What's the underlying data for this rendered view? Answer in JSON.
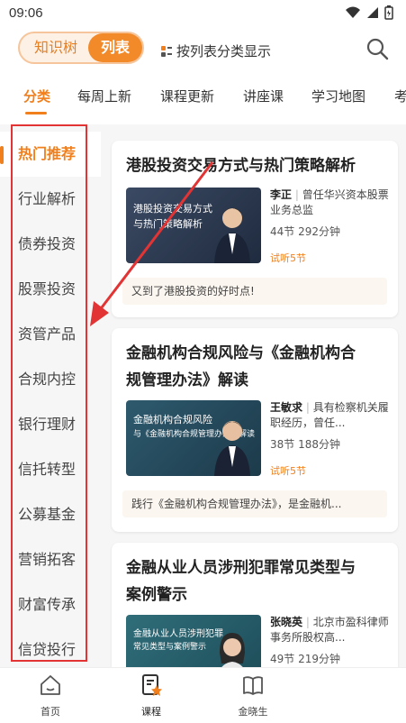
{
  "status": {
    "time": "09:06"
  },
  "header": {
    "toggle_knowledge_tree": "知识树",
    "toggle_list": "列表",
    "mode_label": "按列表分类显示"
  },
  "tabs": [
    "分类",
    "每周上新",
    "课程更新",
    "讲座课",
    "学习地图",
    "考"
  ],
  "sidebar": {
    "items": [
      "热门推荐",
      "行业解析",
      "债券投资",
      "股票投资",
      "资管产品",
      "合规内控",
      "银行理财",
      "信托转型",
      "公募基金",
      "营销拓客",
      "财富传承",
      "信贷投行"
    ]
  },
  "courses": [
    {
      "title_line1": "港股投资交易方式与热门策略解析",
      "title_line2": "",
      "thumb_line1": "港股投资交易方式",
      "thumb_line2": "与热门策略解析",
      "teacher_name": "李正",
      "teacher_desc": "曾任华兴资本股票业务总监",
      "meta": "44节 292分钟",
      "trial": "试听5节",
      "quote": "又到了港股投资的好时点!"
    },
    {
      "title_line1": "金融机构合规风险与《金融机构合",
      "title_line2": "规管理办法》解读",
      "thumb_line1": "金融机构合规风险",
      "thumb_line2": "与《金融机构合规管理办法》解读",
      "teacher_name": "王敏求",
      "teacher_desc": "具有检察机关履职经历，曾任...",
      "meta": "38节 188分钟",
      "trial": "试听5节",
      "quote": "践行《金融机构合规管理办法》，是金融机..."
    },
    {
      "title_line1": "金融从业人员涉刑犯罪常见类型与",
      "title_line2": "案例警示",
      "thumb_line1": "金融从业人员涉刑犯罪",
      "thumb_line2": "常见类型与案例警示",
      "teacher_name": "张晓英",
      "teacher_desc": "北京市盈科律师事务所股权高...",
      "meta": "49节 219分钟",
      "trial": "",
      "quote": ""
    }
  ],
  "bottom_nav": [
    "首页",
    "课程",
    "金晓生"
  ],
  "colors": {
    "accent": "#f07f1c",
    "annotation": "#e23434"
  }
}
